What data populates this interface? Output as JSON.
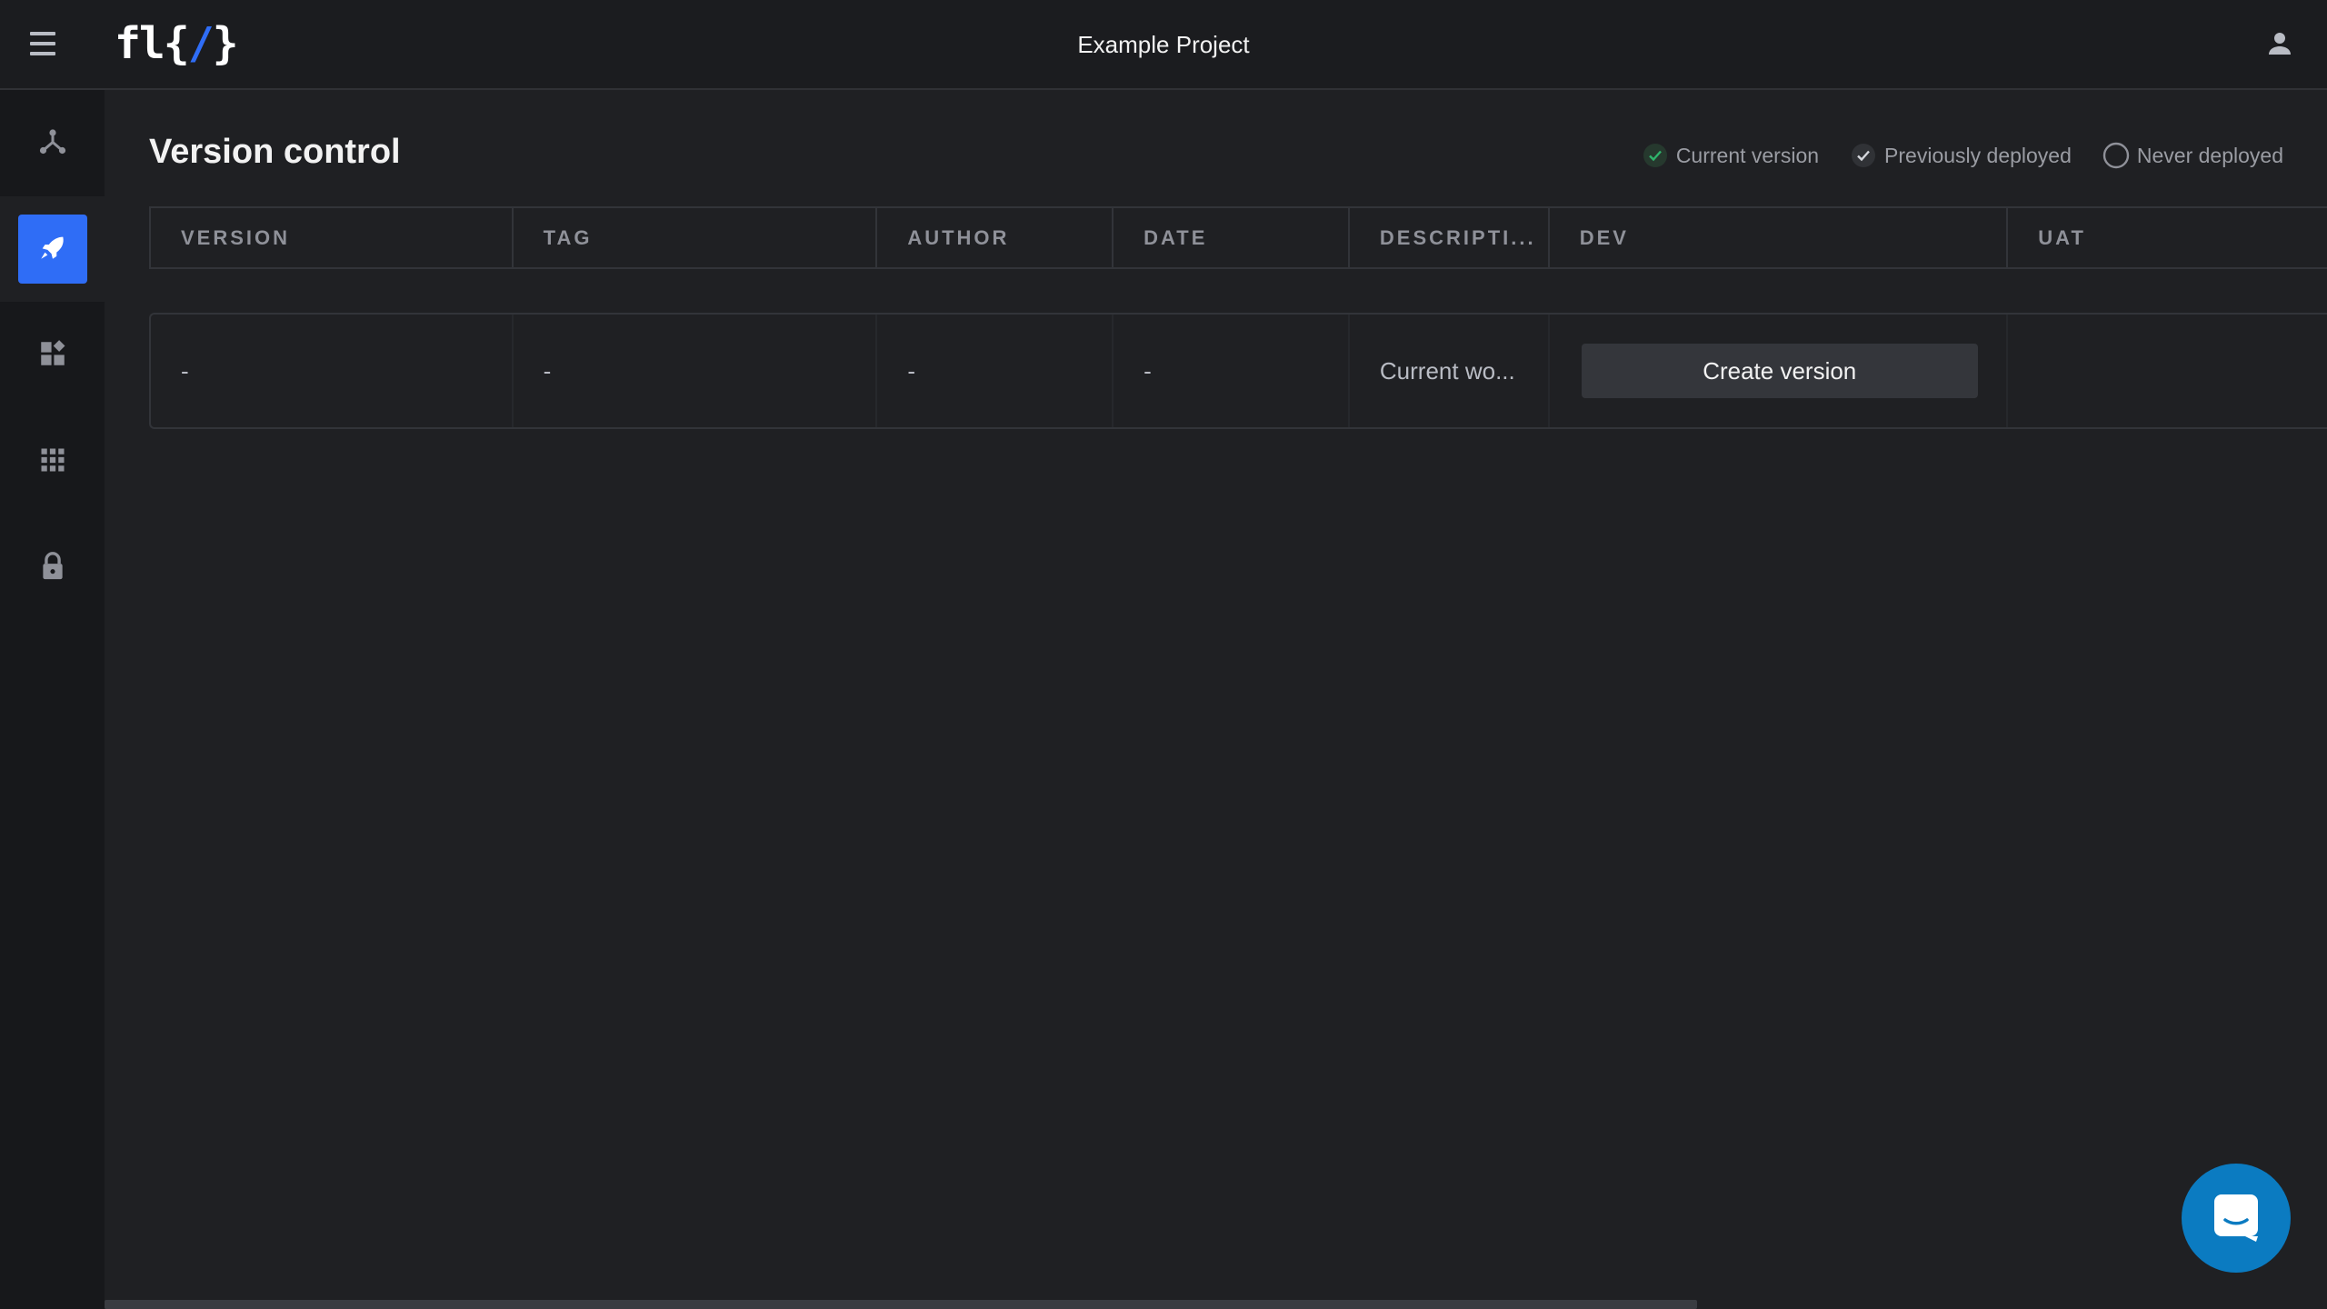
{
  "app": {
    "logo_prefix": "fl",
    "logo_open": "{",
    "logo_slash": "/",
    "logo_close": "}",
    "project_title": "Example Project"
  },
  "icons": {
    "menu": "hamburger-icon",
    "user": "user-icon",
    "sidebar": [
      "flow-icon",
      "rocket-icon",
      "widgets-icon",
      "apps-grid-icon",
      "lock-icon"
    ],
    "chat": "chat-icon"
  },
  "colors": {
    "accent": "#2f6df6",
    "current_check": "#2fb36b",
    "chat_button": "#0b7bc1"
  },
  "page": {
    "title": "Version control"
  },
  "legend": {
    "current": "Current version",
    "previous": "Previously deployed",
    "never": "Never deployed"
  },
  "table": {
    "columns": [
      "VERSION",
      "TAG",
      "AUTHOR",
      "DATE",
      "DESCRIPTI...",
      "DEV",
      "UAT"
    ],
    "row": {
      "version": "-",
      "tag": "-",
      "author": "-",
      "date": "-",
      "description": "Current wo...",
      "dev_button": "Create version",
      "uat": ""
    }
  }
}
